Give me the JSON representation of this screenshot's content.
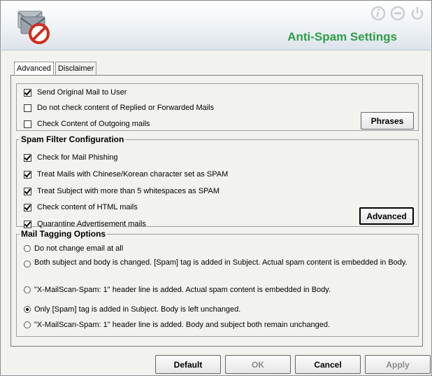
{
  "window": {
    "title": "Anti-Spam Settings"
  },
  "colors": {
    "title_green": "#2e9d47",
    "header_icon_gray": "#c9ced6"
  },
  "header": {
    "logo_icon": "mail-forbidden-icon",
    "icons": [
      "info-icon",
      "minimize-icon",
      "power-icon"
    ]
  },
  "tabs": [
    {
      "label": "Advanced",
      "selected": true
    },
    {
      "label": "Disclaimer",
      "selected": false
    }
  ],
  "general": {
    "options": [
      {
        "label": "Send Original Mail to User",
        "checked": true
      },
      {
        "label": "Do not check content of Replied or Forwarded Mails",
        "checked": false
      },
      {
        "label": "Check Content of Outgoing mails",
        "checked": false
      }
    ],
    "phrases_button": "Phrases"
  },
  "spam_filter": {
    "legend": "Spam Filter Configuration",
    "options": [
      {
        "label": "Check for Mail Phishing",
        "checked": true
      },
      {
        "label": "Treat Mails with Chinese/Korean character set as SPAM",
        "checked": true
      },
      {
        "label": "Treat Subject with more than 5 whitespaces as SPAM",
        "checked": true
      },
      {
        "label": "Check content of HTML mails",
        "checked": true
      },
      {
        "label": "Quarantine Advertisement mails",
        "checked": true
      }
    ],
    "advanced_button": "Advanced"
  },
  "tagging": {
    "legend": "Mail Tagging Options",
    "options": [
      {
        "label": "Do not change email at all",
        "selected": false
      },
      {
        "label": "Both subject and body is changed.  [Spam] tag is added in Subject. Actual spam content is embedded in Body.",
        "selected": false
      },
      {
        "label": "\"X-MailScan-Spam: 1\" header line is added.  Actual spam content is embedded in Body.",
        "selected": false
      },
      {
        "label": "Only [Spam] tag is added in Subject. Body is left unchanged.",
        "selected": true
      },
      {
        "label": "\"X-MailScan-Spam: 1\" header line is added.  Body and subject both remain unchanged.",
        "selected": false
      }
    ]
  },
  "footer": {
    "default": "Default",
    "ok": "OK",
    "cancel": "Cancel",
    "apply": "Apply"
  }
}
